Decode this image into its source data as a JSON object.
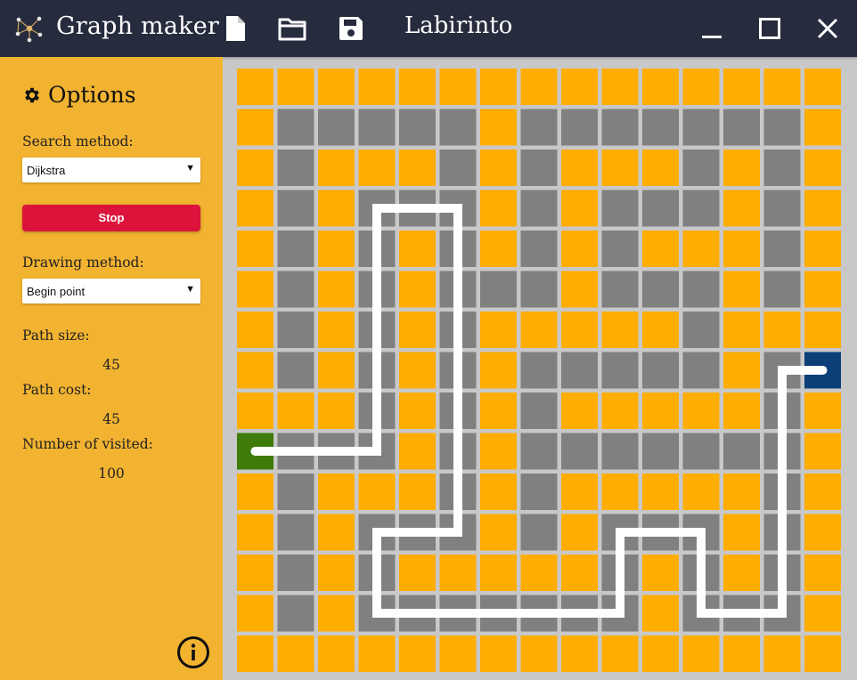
{
  "app": {
    "title": "Graph maker",
    "document_title": "Labirinto"
  },
  "toolbar": {
    "icons": [
      "file-icon",
      "folder-icon",
      "save-icon"
    ],
    "window_controls": [
      "minimize-icon",
      "maximize-icon",
      "close-icon"
    ]
  },
  "sidebar": {
    "heading": "Options",
    "search_method_label": "Search method:",
    "search_method_value": "Dijkstra",
    "stop_label": "Stop",
    "drawing_method_label": "Drawing method:",
    "drawing_method_value": "Begin point",
    "path_size_label": "Path size:",
    "path_size_value": "45",
    "path_cost_label": "Path cost:",
    "path_cost_value": "45",
    "visited_label": "Number of visited:",
    "visited_value": "100"
  },
  "colors": {
    "open": "#ffad00",
    "wall": "#808080",
    "start": "#3e7b0a",
    "end": "#0c3f78",
    "path": "#ffffff",
    "sidebar": "#f2b330",
    "titlebar": "#262b3e",
    "stop_button": "#dc143c"
  },
  "maze": {
    "rows": [
      "OOOOOOOOOOOOOOO",
      "OWWWWWOWWWWWWWO",
      "OWOOOWOWOOOWOWO",
      "OWOWWWOWOWWWOWO",
      "OWOWOWOWOWOOOWO",
      "OWOWOWWWOWWWOWO",
      "OWOWOWOOOOOWOOO",
      "OWOWOWOWWWWWOWE",
      "OOOWOWOWOOOOOWO",
      "SWWWOWOWWWWWWWO",
      "OWOOOWOWOOOOOWO",
      "OWOWWWOWOWWWOWO",
      "OWOWOOOOOWOWOWO",
      "OWOWWWWWWWOWWWO",
      "OOOOOOOOOOOOOOO"
    ],
    "path": [
      [
        0,
        9
      ],
      [
        1,
        9
      ],
      [
        2,
        9
      ],
      [
        3,
        9
      ],
      [
        3,
        8
      ],
      [
        3,
        7
      ],
      [
        3,
        6
      ],
      [
        3,
        5
      ],
      [
        3,
        4
      ],
      [
        3,
        3
      ],
      [
        4,
        3
      ],
      [
        5,
        3
      ],
      [
        5,
        4
      ],
      [
        5,
        5
      ],
      [
        5,
        6
      ],
      [
        5,
        7
      ],
      [
        5,
        8
      ],
      [
        5,
        9
      ],
      [
        5,
        10
      ],
      [
        5,
        11
      ],
      [
        4,
        11
      ],
      [
        3,
        11
      ],
      [
        3,
        12
      ],
      [
        3,
        13
      ],
      [
        4,
        13
      ],
      [
        5,
        13
      ],
      [
        6,
        13
      ],
      [
        7,
        13
      ],
      [
        8,
        13
      ],
      [
        9,
        13
      ],
      [
        9,
        12
      ],
      [
        9,
        11
      ],
      [
        10,
        11
      ],
      [
        11,
        11
      ],
      [
        11,
        12
      ],
      [
        11,
        13
      ],
      [
        12,
        13
      ],
      [
        13,
        13
      ],
      [
        13,
        12
      ],
      [
        13,
        11
      ],
      [
        13,
        10
      ],
      [
        13,
        9
      ],
      [
        13,
        8
      ],
      [
        13,
        7
      ],
      [
        14,
        7
      ]
    ]
  }
}
